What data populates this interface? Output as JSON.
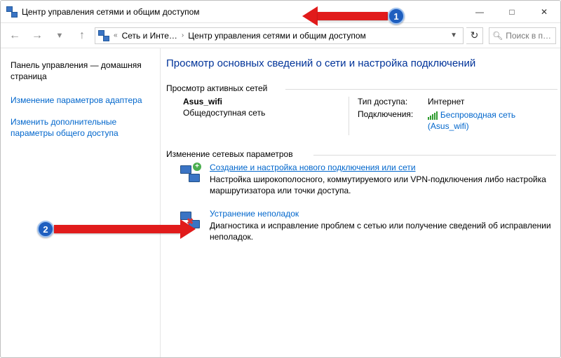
{
  "window": {
    "title": "Центр управления сетями и общим доступом"
  },
  "breadcrumbs": {
    "item1": "Сеть и Инте…",
    "item2": "Центр управления сетями и общим доступом"
  },
  "search": {
    "placeholder": "Поиск в п…"
  },
  "sidebar": {
    "home": "Панель управления — домашняя страница",
    "link_adapter": "Изменение параметров адаптера",
    "link_sharing": "Изменить дополнительные параметры общего доступа"
  },
  "main": {
    "heading": "Просмотр основных сведений о сети и настройка подключений",
    "active_networks_label": "Просмотр активных сетей",
    "network": {
      "name": "Asus_wifi",
      "type": "Общедоступная сеть",
      "access_label": "Тип доступа:",
      "access_value": "Интернет",
      "connections_label": "Подключения:",
      "connection_link": "Беспроводная сеть (Asus_wifi)"
    },
    "settings_label": "Изменение сетевых параметров",
    "opt_create": {
      "title": "Создание и настройка нового подключения или сети",
      "desc": "Настройка широкополосного, коммутируемого или VPN-подключения либо настройка маршрутизатора или точки доступа."
    },
    "opt_troubleshoot": {
      "title": "Устранение неполадок",
      "desc": "Диагностика и исправление проблем с сетью или получение сведений об исправлении неполадок."
    }
  },
  "callouts": {
    "num1": "1",
    "num2": "2"
  }
}
